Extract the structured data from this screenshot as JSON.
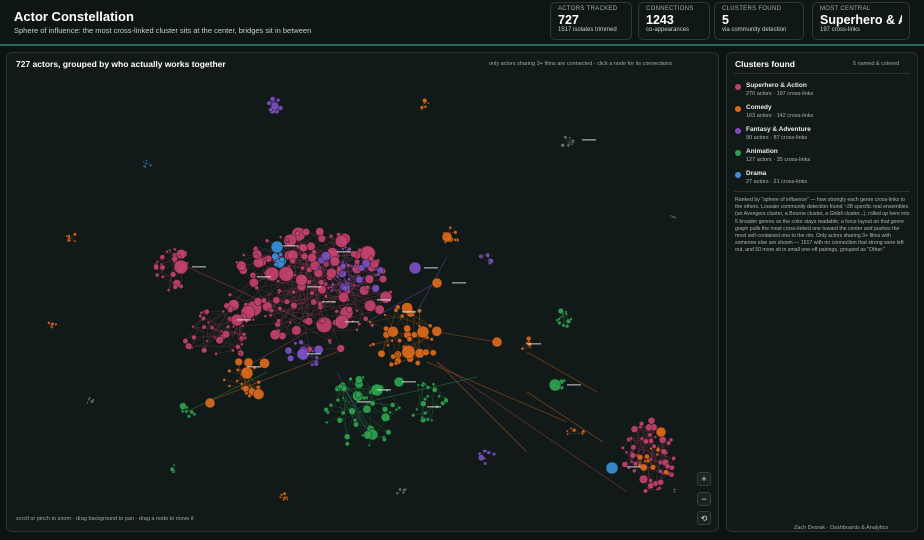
{
  "header": {
    "title": "Actor Constellation",
    "subtitle": "Sphere of influence: the most cross-linked cluster sits at the center, bridges sit in between"
  },
  "kpis": [
    {
      "label": "ACTORS TRACKED",
      "value": "727",
      "sub": "1517 isolates trimmed"
    },
    {
      "label": "CONNECTIONS",
      "value": "1243",
      "sub": "co-appearances"
    },
    {
      "label": "CLUSTERS FOUND",
      "value": "5",
      "sub": "via community detection"
    },
    {
      "label": "MOST CENTRAL",
      "value": "Superhero & Ac...",
      "sub": "197 cross-links"
    }
  ],
  "graph": {
    "title": "727 actors, grouped by who actually works together",
    "hint": "only actors sharing 3+ films are connected · click a node for its connections",
    "footer_hint": "scroll or pinch to zoom · drag background to pan · drag a node to move it",
    "zoom_in": "+",
    "zoom_out": "−",
    "reset": "⟲"
  },
  "clusters": {
    "title": "Clusters found",
    "badge": "5 named & colored",
    "items": [
      {
        "name": "Superhero & Action",
        "sub": "270 actors · 197 cross-links",
        "color": "#c2416f"
      },
      {
        "name": "Comedy",
        "sub": "163 actors · 142 cross-links",
        "color": "#dd6a1c"
      },
      {
        "name": "Fantasy & Adventure",
        "sub": "90 actors · 87 cross-links",
        "color": "#7b4fc0"
      },
      {
        "name": "Animation",
        "sub": "127 actors · 35 cross-links",
        "color": "#2ea24f"
      },
      {
        "name": "Drama",
        "sub": "27 actors · 21 cross-links",
        "color": "#3b8fd8"
      }
    ],
    "description": "Ranked by \"sphere of influence\" — how strongly each genre cross-links to the others. Louvain community detection found ~28 specific real ensembles (an Avengers cluster, a Bourne cluster, a Ghibli cluster...), rolled up here into 5 broader genres so the color stays readable; a force layout on that genre graph pulls the most cross-linked one toward the center and pushes the most self-contained one to the rim. Only actors sharing 3+ films with someone else are shown — 1517 with no connection that strong were left out, and 50 more sit in small one-off pairings, grouped as \"Other.\""
  },
  "credit": "Zach Dvorak · Dashboards & Analytics"
}
